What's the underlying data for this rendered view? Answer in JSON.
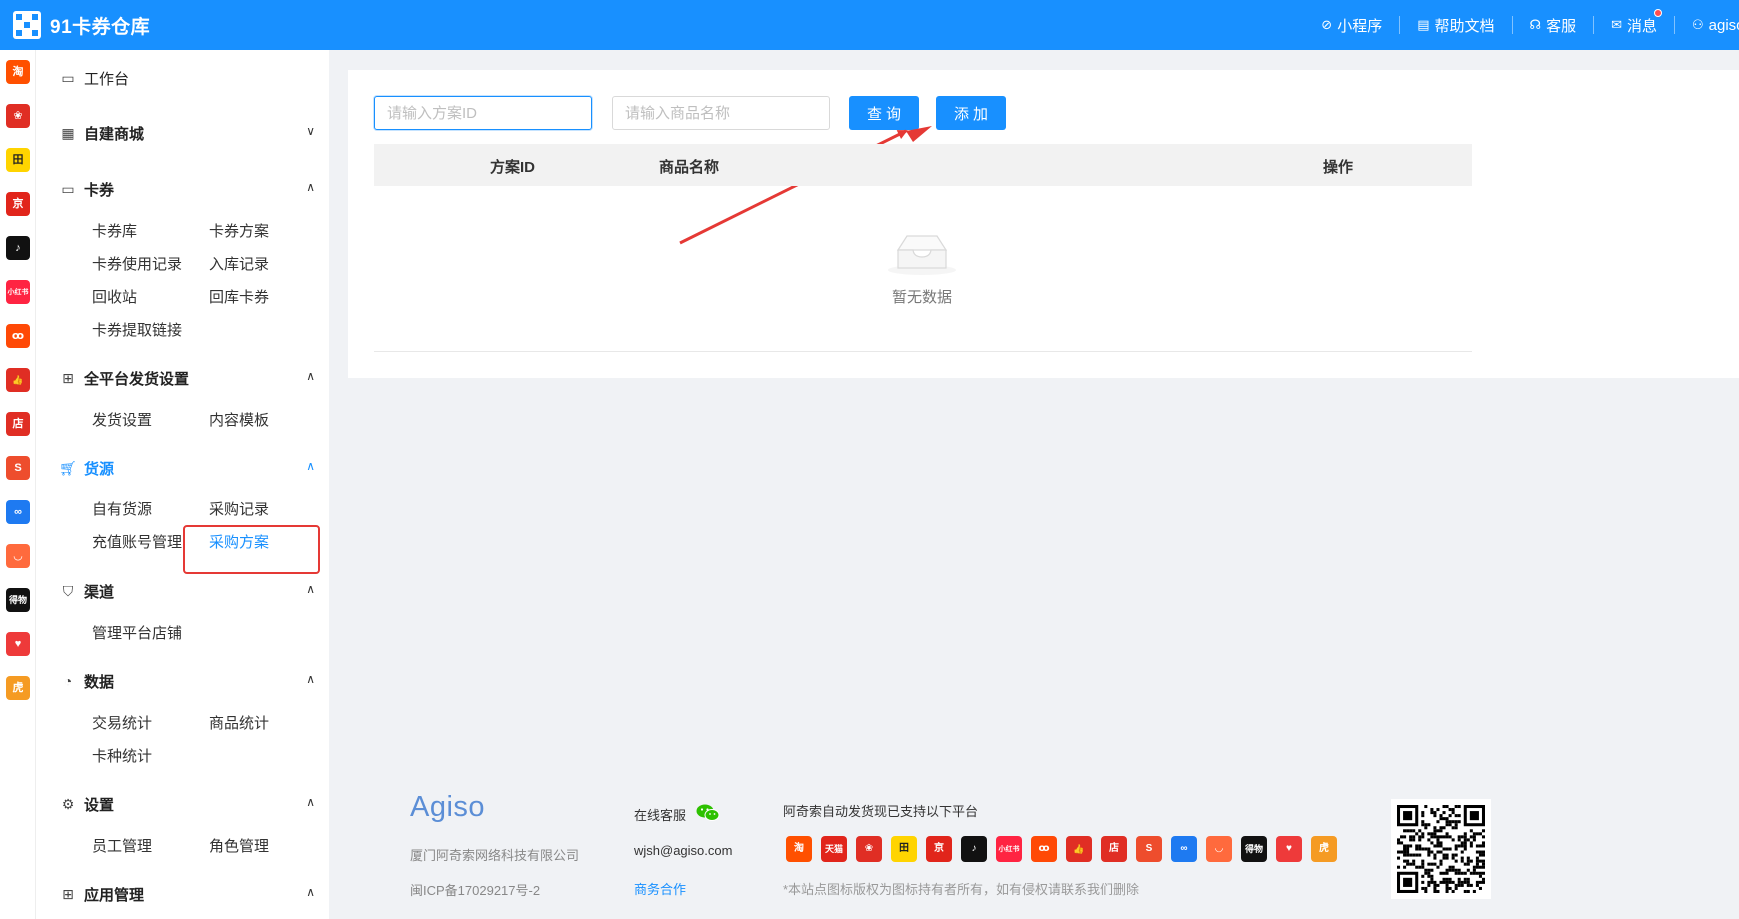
{
  "app": {
    "title": "91卡券仓库"
  },
  "header": {
    "links": [
      {
        "label": "小程序",
        "icon": "mini-program-icon",
        "glyph": "⊘"
      },
      {
        "label": "帮助文档",
        "icon": "document-icon",
        "glyph": "▤"
      },
      {
        "label": "客服",
        "icon": "headset-icon",
        "glyph": "☊"
      },
      {
        "label": "消息",
        "icon": "mail-icon",
        "glyph": "✉"
      },
      {
        "label": "agiso",
        "icon": "user-icon",
        "glyph": "⚇"
      }
    ]
  },
  "platform_rail": [
    {
      "name": "taobao",
      "glyph": "淘",
      "color": "#ff5000"
    },
    {
      "name": "pinduoduo",
      "glyph": "❀",
      "color": "#e02e24"
    },
    {
      "name": "tianmao-yellow",
      "glyph": "田",
      "color": "#ffd400"
    },
    {
      "name": "jd",
      "glyph": "京",
      "color": "#e1251b"
    },
    {
      "name": "douyin",
      "glyph": "♪",
      "color": "#111111"
    },
    {
      "name": "xiaohongshu",
      "glyph": "小红书",
      "color": "#ff2442"
    },
    {
      "name": "kuaishou",
      "glyph": "ꝏ",
      "color": "#ff4906"
    },
    {
      "name": "thumb",
      "glyph": "👍",
      "color": "#e02e24"
    },
    {
      "name": "dian",
      "glyph": "店",
      "color": "#e02e24"
    },
    {
      "name": "shopee",
      "glyph": "S",
      "color": "#ee4d2d"
    },
    {
      "name": "link",
      "glyph": "∞",
      "color": "#1e7af1"
    },
    {
      "name": "face",
      "glyph": "◡",
      "color": "#ff6a3d"
    },
    {
      "name": "dewu",
      "glyph": "得物",
      "color": "#111111"
    },
    {
      "name": "heart",
      "glyph": "♥",
      "color": "#ee3a3a"
    },
    {
      "name": "tiger",
      "glyph": "虎",
      "color": "#f59b23"
    }
  ],
  "sidebar": {
    "workbench": "工作台",
    "sections": [
      {
        "label": "自建商城",
        "items": []
      },
      {
        "label": "卡券",
        "items": [
          "卡券库",
          "卡券方案",
          "卡券使用记录",
          "入库记录",
          "回收站",
          "回库卡券",
          "卡券提取链接"
        ]
      },
      {
        "label": "全平台发货设置",
        "items": [
          "发货设置",
          "内容模板"
        ]
      },
      {
        "label": "货源",
        "items": [
          "自有货源",
          "采购记录",
          "充值账号管理",
          "采购方案"
        ]
      },
      {
        "label": "渠道",
        "items": [
          "管理平台店铺"
        ]
      },
      {
        "label": "数据",
        "items": [
          "交易统计",
          "商品统计",
          "卡种统计"
        ]
      },
      {
        "label": "设置",
        "items": [
          "员工管理",
          "角色管理"
        ]
      },
      {
        "label": "应用管理",
        "items": []
      }
    ]
  },
  "search": {
    "plan_id_placeholder": "请输入方案ID",
    "product_name_placeholder": "请输入商品名称",
    "query_label": "查询",
    "add_label": "添加"
  },
  "table": {
    "columns": [
      "方案ID",
      "商品名称",
      "操作"
    ],
    "rows": [],
    "empty_text": "暂无数据"
  },
  "footer": {
    "brand": "Agiso",
    "company": "厦门阿奇索网络科技有限公司",
    "icp": "闽ICP备17029217号-2",
    "online_service": "在线客服",
    "email": "wjsh@agiso.com",
    "business": "商务合作",
    "platforms_title": "阿奇索自动发货现已支持以下平台",
    "disclaimer": "*本站点图标版权为图标持有者所有，如有侵权请联系我们删除",
    "platforms": [
      {
        "name": "taobao",
        "glyph": "淘",
        "color": "#ff5000"
      },
      {
        "name": "tmall",
        "glyph": "天猫",
        "color": "#e1251b"
      },
      {
        "name": "pinduoduo",
        "glyph": "❀",
        "color": "#e02e24"
      },
      {
        "name": "tianmao-yellow",
        "glyph": "田",
        "color": "#ffd400"
      },
      {
        "name": "jd",
        "glyph": "京",
        "color": "#e1251b"
      },
      {
        "name": "douyin",
        "glyph": "♪",
        "color": "#111111"
      },
      {
        "name": "xiaohongshu",
        "glyph": "小红书",
        "color": "#ff2442"
      },
      {
        "name": "kuaishou",
        "glyph": "ꝏ",
        "color": "#ff4906"
      },
      {
        "name": "thumb",
        "glyph": "👍",
        "color": "#e02e24"
      },
      {
        "name": "dian",
        "glyph": "店",
        "color": "#e02e24"
      },
      {
        "name": "shopee",
        "glyph": "S",
        "color": "#ee4d2d"
      },
      {
        "name": "link",
        "glyph": "∞",
        "color": "#1e7af1"
      },
      {
        "name": "face",
        "glyph": "◡",
        "color": "#ff6a3d"
      },
      {
        "name": "dewu",
        "glyph": "得物",
        "color": "#111111"
      },
      {
        "name": "heart",
        "glyph": "♥",
        "color": "#ee3a3a"
      },
      {
        "name": "tiger",
        "glyph": "虎",
        "color": "#f59b23"
      }
    ]
  },
  "colors": {
    "primary": "#1890ff",
    "highlight": "#e53935"
  }
}
